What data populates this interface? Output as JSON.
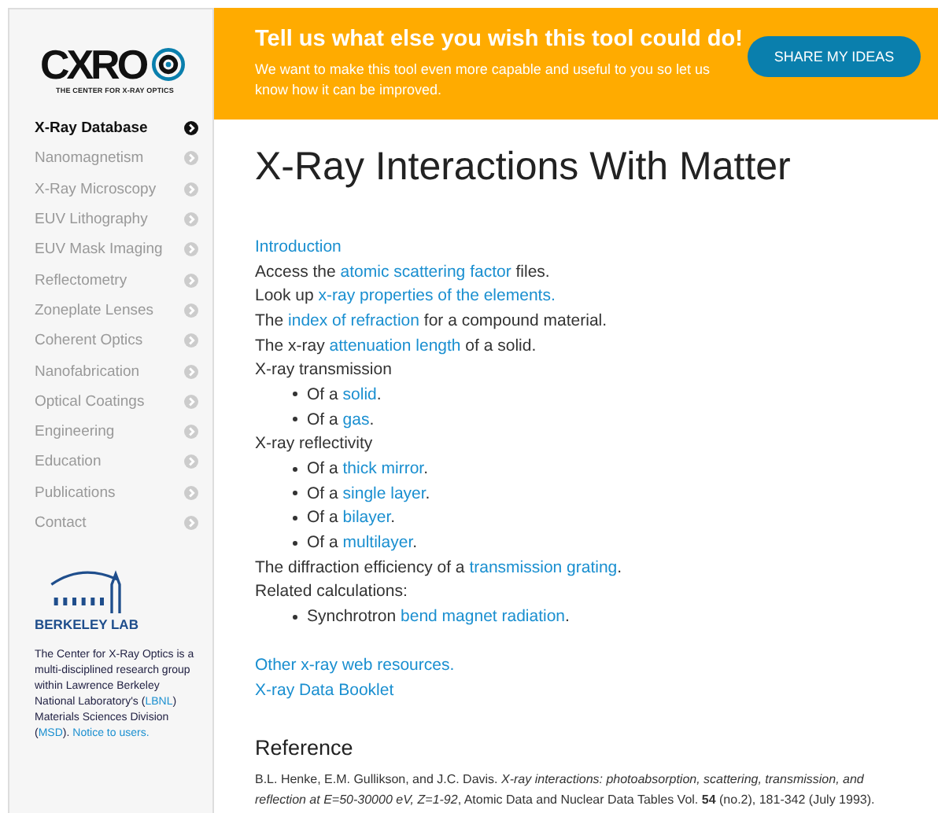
{
  "logo": {
    "wordmark": "CXRO",
    "tagline": "THE CENTER FOR X-RAY OPTICS"
  },
  "sidebar": {
    "items": [
      {
        "label": "X-Ray Database",
        "selected": true
      },
      {
        "label": "Nanomagnetism",
        "selected": false
      },
      {
        "label": "X-Ray Microscopy",
        "selected": false
      },
      {
        "label": "EUV Lithography",
        "selected": false
      },
      {
        "label": "EUV Mask Imaging",
        "selected": false
      },
      {
        "label": "Reflectometry",
        "selected": false
      },
      {
        "label": "Zoneplate Lenses",
        "selected": false
      },
      {
        "label": "Coherent Optics",
        "selected": false
      },
      {
        "label": "Nanofabrication",
        "selected": false
      },
      {
        "label": "Optical Coatings",
        "selected": false
      },
      {
        "label": "Engineering",
        "selected": false
      },
      {
        "label": "Education",
        "selected": false
      },
      {
        "label": "Publications",
        "selected": false
      },
      {
        "label": "Contact",
        "selected": false
      }
    ],
    "lab_name": "BERKELEY LAB",
    "about": [
      {
        "text": "The Center for X-Ray Optics is a multi-disciplined research group within Lawrence Berkeley National Laboratory's (",
        "link": false
      },
      {
        "text": "LBNL",
        "link": true
      },
      {
        "text": ") Materials Sciences Division (",
        "link": false
      },
      {
        "text": "MSD",
        "link": true
      },
      {
        "text": "). ",
        "link": false
      },
      {
        "text": "Notice to users.",
        "link": true
      }
    ]
  },
  "banner": {
    "title": "Tell us what else you wish this tool could do!",
    "text": "We want to make this tool even more capable and useful to you so let us know how it can be improved.",
    "button": "SHARE MY IDEAS"
  },
  "title": "X-Ray Interactions With Matter",
  "lines": [
    {
      "kind": "text",
      "parts": [
        {
          "text": "Introduction",
          "link": true
        }
      ]
    },
    {
      "kind": "text",
      "parts": [
        {
          "text": "Access the ",
          "link": false
        },
        {
          "text": "atomic scattering factor",
          "link": true
        },
        {
          "text": " files.",
          "link": false
        }
      ]
    },
    {
      "kind": "text",
      "parts": [
        {
          "text": "Look up ",
          "link": false
        },
        {
          "text": "x-ray properties of the elements.",
          "link": true
        }
      ]
    },
    {
      "kind": "text",
      "parts": [
        {
          "text": "The ",
          "link": false
        },
        {
          "text": "index of refraction",
          "link": true
        },
        {
          "text": " for a compound material.",
          "link": false
        }
      ]
    },
    {
      "kind": "text",
      "parts": [
        {
          "text": "The x-ray ",
          "link": false
        },
        {
          "text": "attenuation length",
          "link": true
        },
        {
          "text": " of a solid.",
          "link": false
        }
      ]
    },
    {
      "kind": "text",
      "parts": [
        {
          "text": "X-ray transmission",
          "link": false
        }
      ]
    },
    {
      "kind": "bullet",
      "parts": [
        {
          "text": "Of a ",
          "link": false
        },
        {
          "text": "solid",
          "link": true
        },
        {
          "text": ".",
          "link": false
        }
      ]
    },
    {
      "kind": "bullet",
      "parts": [
        {
          "text": "Of a ",
          "link": false
        },
        {
          "text": "gas",
          "link": true
        },
        {
          "text": ".",
          "link": false
        }
      ]
    },
    {
      "kind": "text",
      "parts": [
        {
          "text": "X-ray reflectivity",
          "link": false
        }
      ]
    },
    {
      "kind": "bullet",
      "parts": [
        {
          "text": "Of a ",
          "link": false
        },
        {
          "text": "thick mirror",
          "link": true
        },
        {
          "text": ".",
          "link": false
        }
      ]
    },
    {
      "kind": "bullet",
      "parts": [
        {
          "text": "Of a ",
          "link": false
        },
        {
          "text": "single layer",
          "link": true
        },
        {
          "text": ".",
          "link": false
        }
      ]
    },
    {
      "kind": "bullet",
      "parts": [
        {
          "text": "Of a ",
          "link": false
        },
        {
          "text": "bilayer",
          "link": true
        },
        {
          "text": ".",
          "link": false
        }
      ]
    },
    {
      "kind": "bullet",
      "parts": [
        {
          "text": "Of a ",
          "link": false
        },
        {
          "text": "multilayer",
          "link": true
        },
        {
          "text": ".",
          "link": false
        }
      ]
    },
    {
      "kind": "text",
      "parts": [
        {
          "text": "The diffraction efficiency of a ",
          "link": false
        },
        {
          "text": "transmission grating",
          "link": true
        },
        {
          "text": ".",
          "link": false
        }
      ]
    },
    {
      "kind": "text",
      "parts": [
        {
          "text": "Related calculations:",
          "link": false
        }
      ]
    },
    {
      "kind": "bullet",
      "parts": [
        {
          "text": "Synchrotron ",
          "link": false
        },
        {
          "text": "bend magnet radiation",
          "link": true
        },
        {
          "text": ".",
          "link": false
        }
      ]
    },
    {
      "kind": "gap"
    },
    {
      "kind": "text",
      "parts": [
        {
          "text": "Other x-ray web resources.",
          "link": true
        }
      ]
    },
    {
      "kind": "text",
      "parts": [
        {
          "text": "X-ray Data Booklet",
          "link": true
        }
      ]
    }
  ],
  "reference": {
    "heading": "Reference",
    "text": "B.L. Henke, E.M. Gullikson, and J.C. Davis. *X-ray interactions: photoabsorption, scattering, transmission, and reflection at E=50-30000 eV, Z=1-92*, Atomic Data and Nuclear Data Tables Vol. **54** (no.2), 181-342 (July 1993)."
  }
}
